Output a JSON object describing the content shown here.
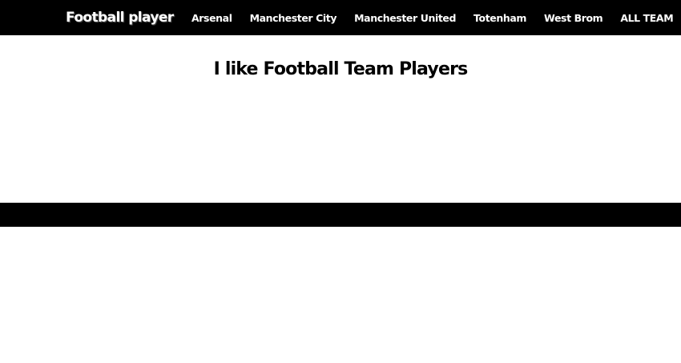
{
  "navbar": {
    "brand": "Football player",
    "links": [
      {
        "label": "Arsenal"
      },
      {
        "label": "Manchester City"
      },
      {
        "label": "Manchester United"
      },
      {
        "label": "Totenham"
      },
      {
        "label": "West Brom"
      },
      {
        "label": "ALL TEAM"
      }
    ]
  },
  "hero": {
    "title": "I like Football Team Players"
  },
  "colors": {
    "navbar_bg": "#000000",
    "nav_text": "#ffffff",
    "page_bg": "#ffffff",
    "footer_bg": "#000000"
  }
}
